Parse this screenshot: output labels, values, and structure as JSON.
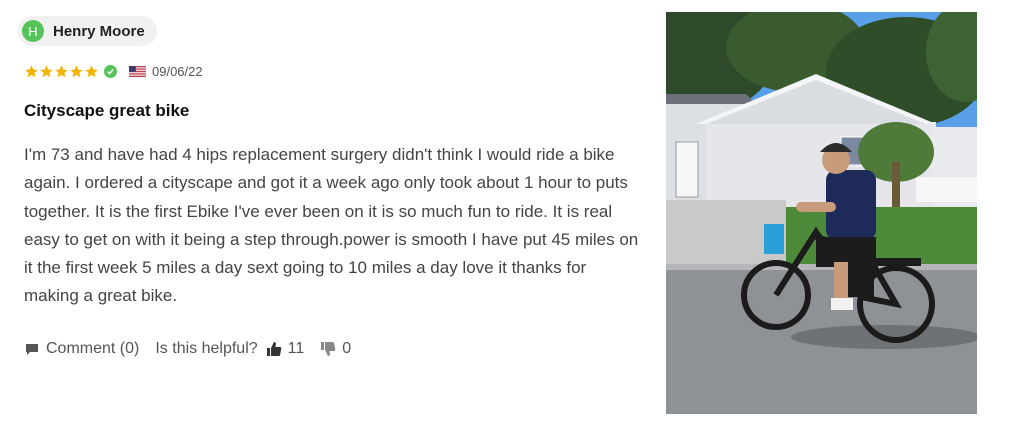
{
  "review": {
    "author": {
      "initial": "H",
      "name": "Henry Moore"
    },
    "rating": 5,
    "verified_icon": "check-circle-icon",
    "country_flag": "us-flag-icon",
    "date": "09/06/22",
    "title": "Cityscape great bike",
    "body": "I'm 73 and have had 4 hips replacement surgery didn't think I would ride a bike again. I ordered a cityscape and got it a week ago only took about 1 hour to puts together. It is the first Ebike I've ever been on it is so much fun to ride. It is real easy to get on with it being a step through.power is smooth I have put 45 miles on it the first week 5 miles a day sext going to 10 miles a day love it thanks for making a great bike.",
    "comment_label": "Comment (0)",
    "helpful_prompt": "Is this helpful?",
    "upvotes": "11",
    "downvotes": "0"
  },
  "colors": {
    "avatar": "#55c35a",
    "star": "#f5b301",
    "verified": "#55c35a"
  }
}
